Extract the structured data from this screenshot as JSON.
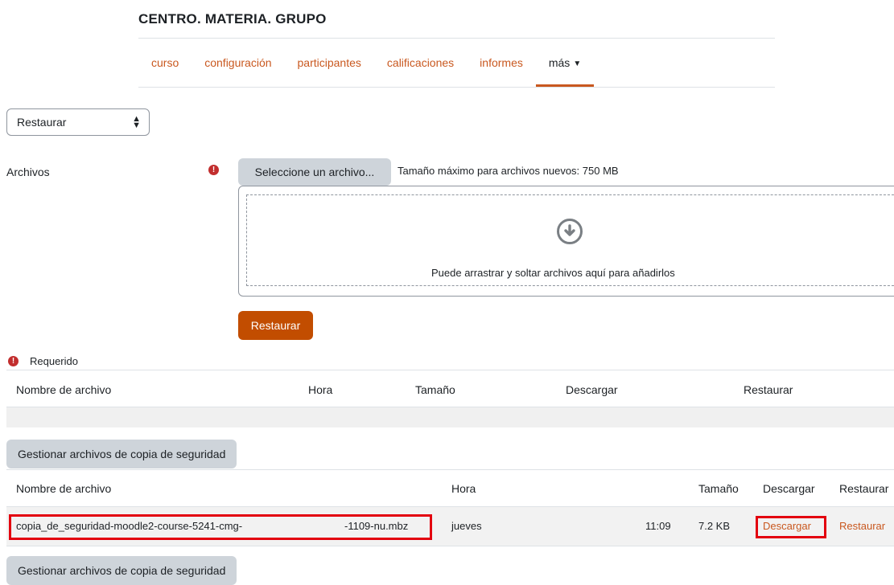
{
  "header": {
    "course_title": "CENTRO. MATERIA. GRUPO"
  },
  "nav": {
    "tabs": [
      {
        "label": "curso"
      },
      {
        "label": "configuración"
      },
      {
        "label": "participantes"
      },
      {
        "label": "calificaciones"
      },
      {
        "label": "informes"
      },
      {
        "label": "más"
      }
    ]
  },
  "action_select": {
    "value": "Restaurar"
  },
  "upload": {
    "label": "Archivos",
    "select_button": "Seleccione un archivo...",
    "max_size": "Tamaño máximo para archivos nuevos: 750 MB",
    "drop_text": "Puede arrastrar y soltar archivos aquí para añadirlos",
    "restore_button": "Restaurar",
    "required_icon": "exclamation-circle-icon",
    "required_legend": "Requerido"
  },
  "table_headers": {
    "filename": "Nombre de archivo",
    "time": "Hora",
    "size": "Tamaño",
    "download": "Descargar",
    "restore": "Restaurar"
  },
  "manage_button": "Gestionar archivos de copia de seguridad",
  "backup_rows": [
    {
      "filename_start": "copia_de_seguridad-moodle2-course-5241-cmg-",
      "filename_end": "-1109-nu.mbz",
      "day": "jueves",
      "time": "11:09",
      "size": "7.2 KB",
      "download": "Descargar",
      "restore": "Restaurar"
    }
  ],
  "colors": {
    "accent": "#c9581f",
    "primary_button": "#c24d00",
    "highlight": "#e3000f"
  }
}
